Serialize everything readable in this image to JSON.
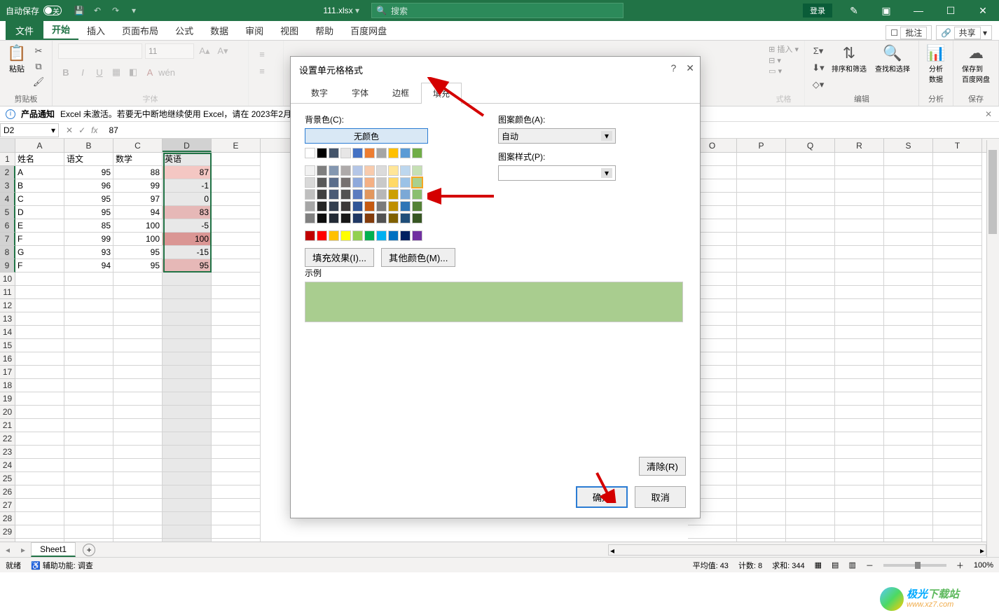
{
  "titlebar": {
    "autosave_label": "自动保存",
    "filename": "111.xlsx",
    "search_placeholder": "搜索",
    "login": "登录"
  },
  "ribbon_tabs": {
    "file": "文件",
    "home": "开始",
    "insert": "插入",
    "layout": "页面布局",
    "formulas": "公式",
    "data": "数据",
    "review": "审阅",
    "view": "视图",
    "help": "帮助",
    "baidu": "百度网盘",
    "comments": "批注",
    "share": "共享"
  },
  "ribbon_groups": {
    "clipboard": "剪贴板",
    "paste": "粘贴",
    "font_group": "字体",
    "cells": "式格",
    "editing": "编辑",
    "sort_filter": "排序和筛选",
    "find_select": "查找和选择",
    "analysis": "分析",
    "analysis_data": "分析\n数据",
    "save": "保存",
    "save_to": "保存到\n百度网盘",
    "insert_cells": "插入"
  },
  "notice": {
    "prefix": "产品通知",
    "text": "Excel 未激活。若要无中断地继续使用 Excel，请在 2023年2月"
  },
  "formula_bar": {
    "namebox": "D2",
    "fx": "fx",
    "value": "87"
  },
  "columns": [
    "A",
    "B",
    "C",
    "D",
    "E",
    "O",
    "P",
    "Q",
    "R",
    "S",
    "T"
  ],
  "grid": {
    "headers": {
      "a": "姓名",
      "b": "语文",
      "c": "数学",
      "d": "英语"
    },
    "rows": [
      {
        "a": "A",
        "b": "95",
        "c": "88",
        "d": "87",
        "cls": "pink1"
      },
      {
        "a": "B",
        "b": "96",
        "c": "99",
        "d": "-1",
        "cls": ""
      },
      {
        "a": "C",
        "b": "95",
        "c": "97",
        "d": "0",
        "cls": ""
      },
      {
        "a": "D",
        "b": "95",
        "c": "94",
        "d": "83",
        "cls": "pink2"
      },
      {
        "a": "E",
        "b": "85",
        "c": "100",
        "d": "-5",
        "cls": ""
      },
      {
        "a": "F",
        "b": "99",
        "c": "100",
        "d": "100",
        "cls": "pink3"
      },
      {
        "a": "G",
        "b": "93",
        "c": "95",
        "d": "-15",
        "cls": ""
      },
      {
        "a": "F",
        "b": "94",
        "c": "95",
        "d": "95",
        "cls": "pink2"
      }
    ]
  },
  "sheet": {
    "name": "Sheet1"
  },
  "statusbar": {
    "ready": "就绪",
    "access": "辅助功能: 调查",
    "avg": "平均值: 43",
    "count": "计数: 8",
    "sum": "求和: 344",
    "zoom": "100%"
  },
  "dialog": {
    "title": "设置单元格格式",
    "tabs": {
      "number": "数字",
      "font": "字体",
      "border": "边框",
      "fill": "填充"
    },
    "bg_label": "背景色(C):",
    "no_color": "无颜色",
    "pattern_color_label": "图案颜色(A):",
    "auto": "自动",
    "pattern_style_label": "图案样式(P):",
    "fill_effects": "填充效果(I)...",
    "more_colors": "其他颜色(M)...",
    "sample": "示例",
    "clear": "清除(R)",
    "ok": "确定",
    "cancel": "取消"
  },
  "palette": {
    "row0": [
      "#ffffff",
      "#000000",
      "#44546a",
      "#e7e6e6",
      "#4472c4",
      "#ed7d31",
      "#a5a5a5",
      "#ffc000",
      "#5b9bd5",
      "#70ad47"
    ],
    "row1": [
      "#f2f2f2",
      "#7f7f7f",
      "#8497b0",
      "#aeaaaa",
      "#b4c6e7",
      "#f8cbad",
      "#dbdbdb",
      "#ffe699",
      "#bdd7ee",
      "#c6e0b4"
    ],
    "row2": [
      "#d9d9d9",
      "#595959",
      "#5b6d8a",
      "#767171",
      "#8ea9db",
      "#f4b084",
      "#c9c9c9",
      "#ffd966",
      "#9bc2e6",
      "#a9d08e"
    ],
    "row3": [
      "#bfbfbf",
      "#404040",
      "#495a75",
      "#525252",
      "#5b7bbf",
      "#e2975d",
      "#b7b7b7",
      "#cc9f00",
      "#7ba8d6",
      "#8bbf6f"
    ],
    "row4": [
      "#a6a6a6",
      "#262626",
      "#333f50",
      "#3b3838",
      "#2f5597",
      "#c55a11",
      "#7b7b7b",
      "#bf8f00",
      "#2e75b6",
      "#548235"
    ],
    "row5": [
      "#808080",
      "#0d0d0d",
      "#222a35",
      "#171717",
      "#203864",
      "#833c0c",
      "#525252",
      "#806000",
      "#1f4e79",
      "#375623"
    ],
    "std": [
      "#c00000",
      "#ff0000",
      "#ffc000",
      "#ffff00",
      "#92d050",
      "#00b050",
      "#00b0f0",
      "#0070c0",
      "#002060",
      "#7030a0"
    ]
  },
  "watermark": {
    "cn1": "极光",
    "cn2": "下载站",
    "url": "www.xz7.com"
  }
}
